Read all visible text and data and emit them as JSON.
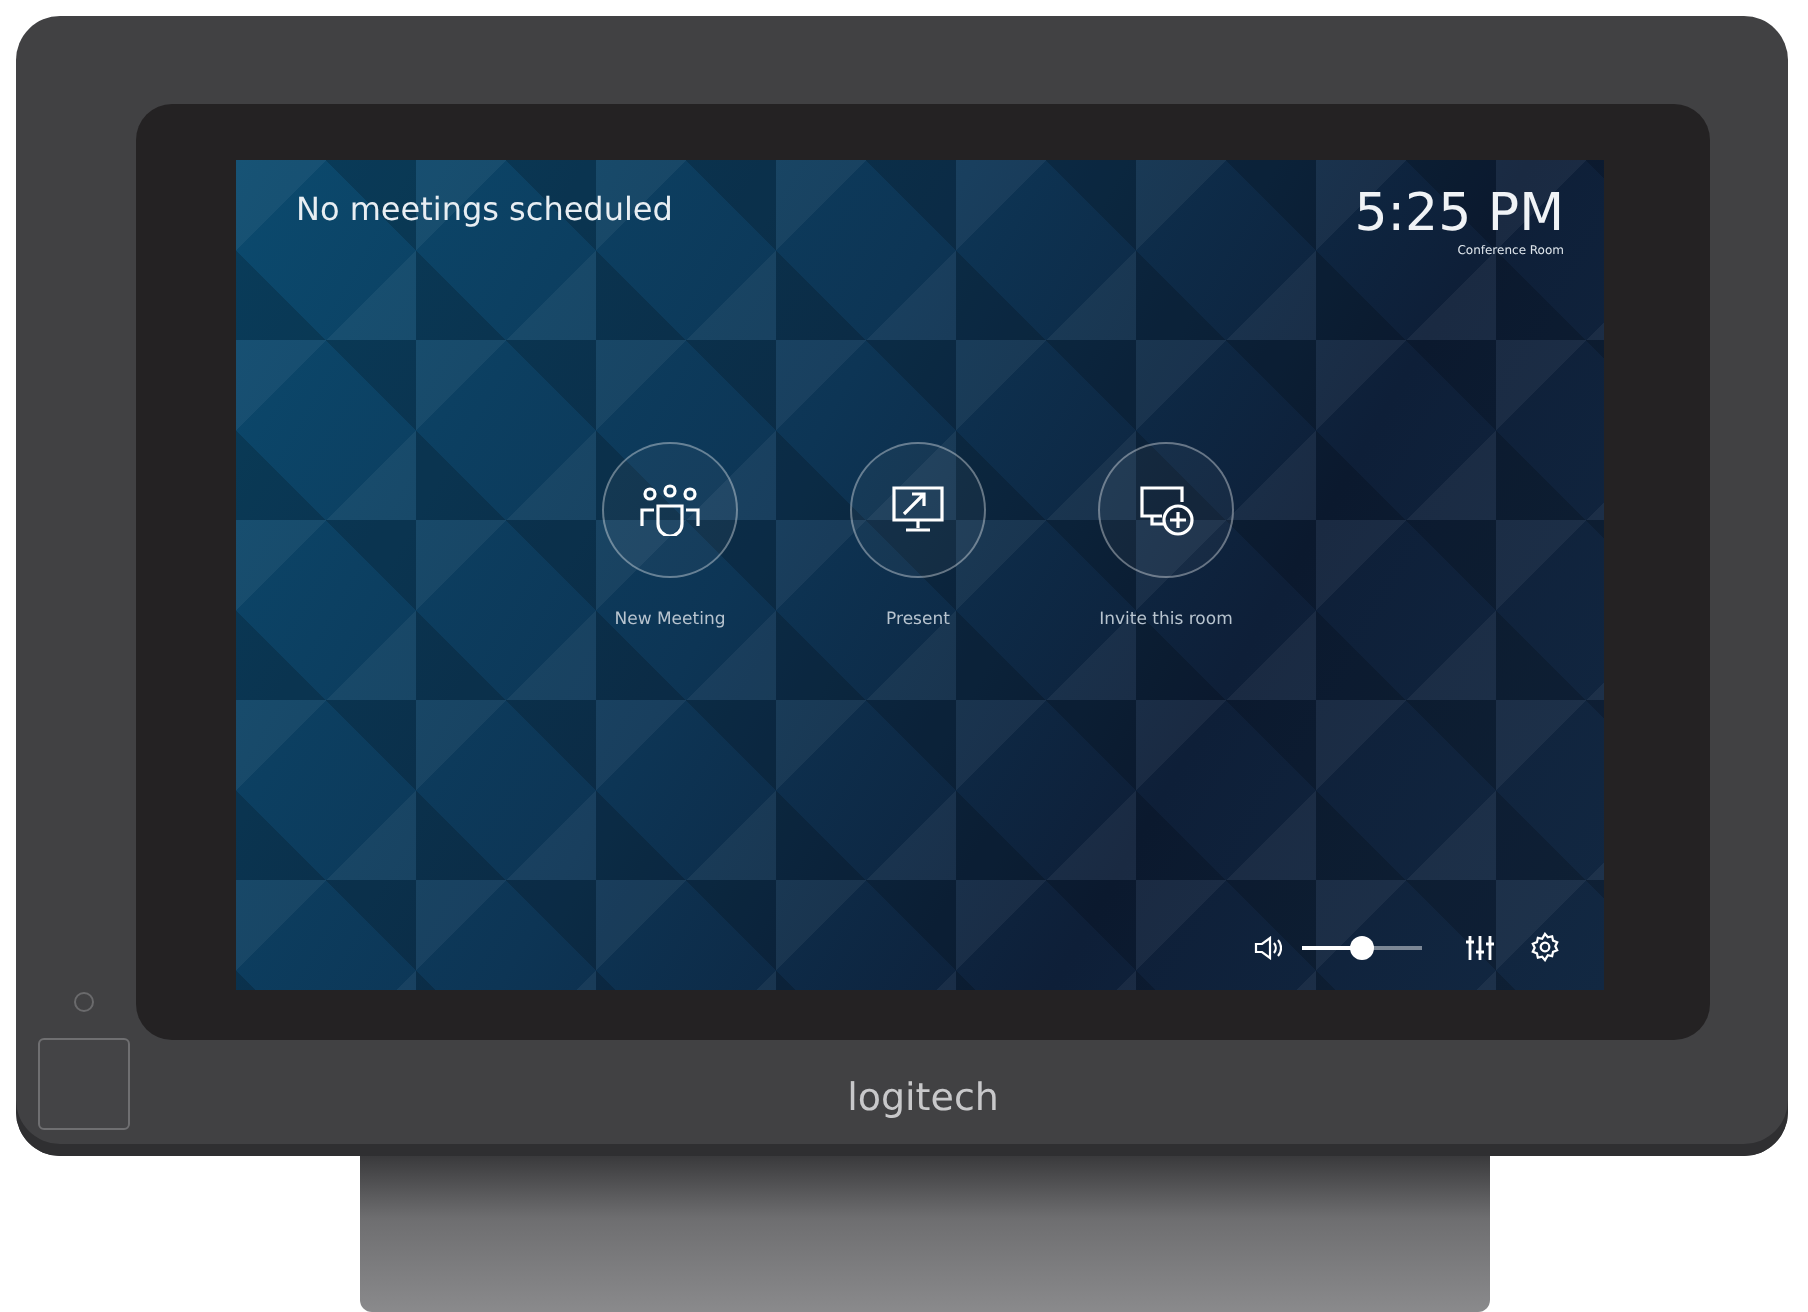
{
  "screen": {
    "status_message": "No meetings scheduled",
    "clock": "5:25 PM",
    "room_name": "Conference Room"
  },
  "actions": [
    {
      "kind": "meeting",
      "label": "New Meeting"
    },
    {
      "kind": "present",
      "label": "Present"
    },
    {
      "kind": "invite",
      "label": "Invite this room"
    }
  ],
  "volume": {
    "level": 0.5
  },
  "device": {
    "brand": "logitech"
  }
}
